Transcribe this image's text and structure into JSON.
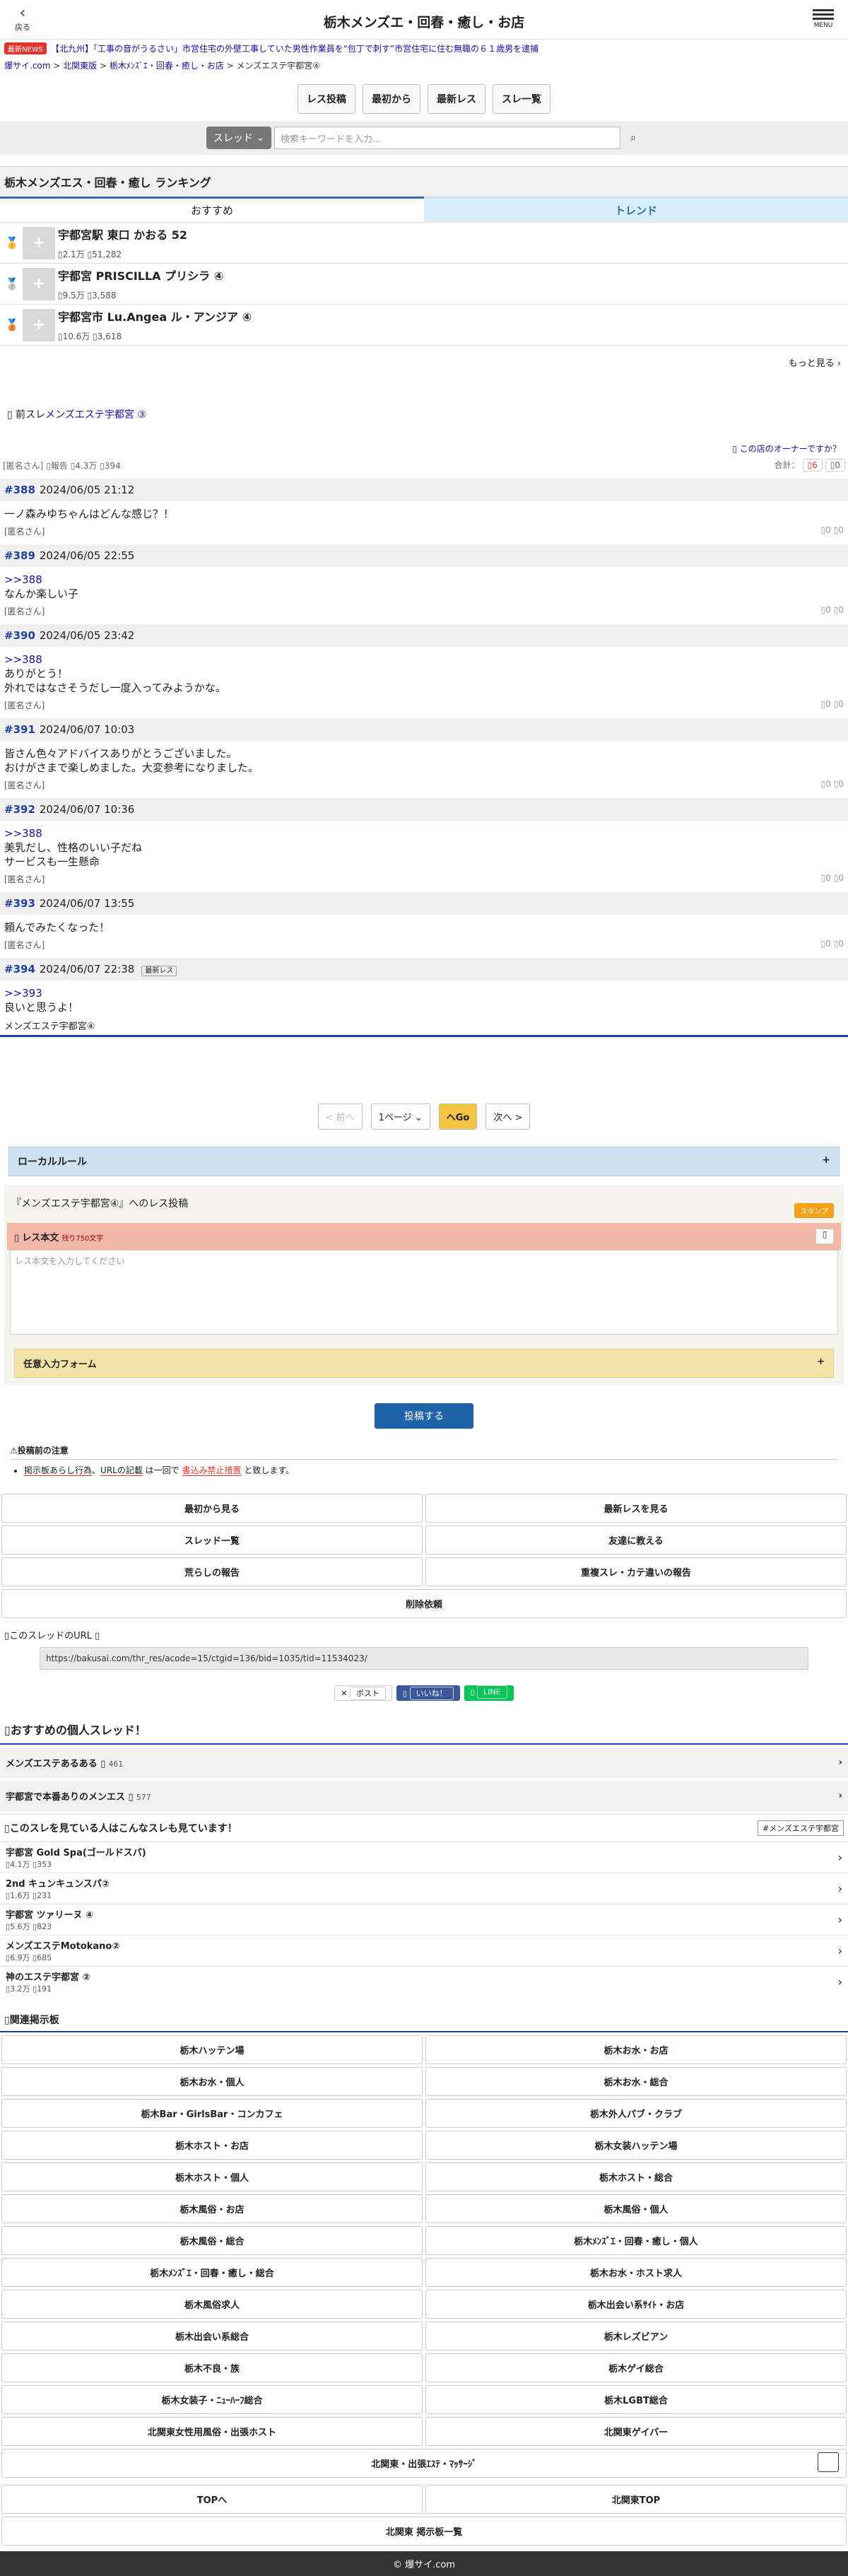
{
  "header": {
    "back_label": "戻る",
    "back_icon": "chevron-left-icon",
    "title": "栃木メンズエ・回春・癒し・お店",
    "menu_label": "MENU",
    "menu_icon": "hamburger-icon"
  },
  "news": {
    "badge": "最新NEWS",
    "text": "【北九州】「工事の音がうるさい」市営住宅の外壁工事していた男性作業員を“包丁で刺す”市営住宅に住む無職の６１歳男を逮捕"
  },
  "breadcrumb": {
    "home": "爆サイ.com",
    "area": "北関東版",
    "board": "栃木ﾒﾝｽﾞｴ・回春・癒し・お店",
    "thread": "メンズエステ宇都宮④"
  },
  "toolbar": {
    "post": "レス投稿",
    "first": "最初から",
    "latest": "最新レス",
    "list": "スレ一覧"
  },
  "search": {
    "select": "スレッド",
    "placeholder": "検索キーワードを入力...",
    "icon": "search-icon"
  },
  "ranking": {
    "title": "栃木メンズエス・回春・癒し ランキング",
    "tab1": "おすすめ",
    "tab2": "トレンド",
    "more": "もっと見る",
    "items": [
      {
        "medal": "gold-medal-icon",
        "title": "宇都宮駅 東口 かおる 52",
        "views": "2.1万",
        "comments": "51,282"
      },
      {
        "medal": "silver-medal-icon",
        "title": "宇都宮 PRISCILLA プリシラ ④",
        "views": "9.5万",
        "comments": "3,588"
      },
      {
        "medal": "bronze-medal-icon",
        "title": "宇都宮市 Lu.Angea ル・アンジア ④",
        "views": "10.6万",
        "comments": "3,618"
      }
    ]
  },
  "thread": {
    "prev_prefix": "前スレ",
    "prev_link": "メンズエステ宇都宮 ③",
    "owner_link": "この店のオーナーですか？",
    "author": "[匿名さん]",
    "report": "報告",
    "views": "4.3万",
    "comments": "394",
    "total_label": "合計：",
    "up_votes": "6",
    "down_votes": "0",
    "posts": [
      {
        "no": "#388",
        "date": "2024/06/05 21:12",
        "anchor": "",
        "body": "一ノ森みゆちゃんはどんな感じ？！",
        "author": "[匿名さん]",
        "up": "0",
        "down": "0"
      },
      {
        "no": "#389",
        "date": "2024/06/05 22:55",
        "anchor": ">>388",
        "body": "なんか楽しい子",
        "author": "[匿名さん]",
        "up": "0",
        "down": "0"
      },
      {
        "no": "#390",
        "date": "2024/06/05 23:42",
        "anchor": ">>388",
        "body": "ありがとう！\n外れではなさそうだし一度入ってみようかな。",
        "author": "[匿名さん]",
        "up": "0",
        "down": "0"
      },
      {
        "no": "#391",
        "date": "2024/06/07 10:03",
        "anchor": "",
        "body": "皆さん色々アドバイスありがとうございました。\nおけがさまで楽しめました。大変参考になりました。",
        "author": "[匿名さん]",
        "up": "0",
        "down": "0"
      },
      {
        "no": "#392",
        "date": "2024/06/07 10:36",
        "anchor": ">>388",
        "body": "美乳だし、性格のいい子だね\nサービスも一生懸命",
        "author": "[匿名さん]",
        "up": "0",
        "down": "0"
      },
      {
        "no": "#393",
        "date": "2024/06/07 13:55",
        "anchor": "",
        "body": "頼んでみたくなった！",
        "author": "[匿名さん]",
        "up": "0",
        "down": "0"
      },
      {
        "no": "#394",
        "date": "2024/06/07 22:38",
        "anchor": ">>393",
        "body": "良いと思うよ！",
        "author": "",
        "up": "",
        "down": "",
        "tag": "最新レス"
      }
    ],
    "end_label": "メンズエステ宇都宮④"
  },
  "pager": {
    "prev": "< 前へ",
    "select": "1ページ",
    "go": "へGo",
    "next": "次へ >"
  },
  "local_rule": {
    "label": "ローカルルール",
    "plus": "+"
  },
  "form": {
    "label": "『メンズエステ宇都宮④』へのレス投稿",
    "stamp": "スタンプ",
    "field": "レス本文",
    "remaining": "残り750文字",
    "placeholder": "レス本文を入力してください",
    "optional": "任意入力フォーム",
    "submit": "投稿する"
  },
  "notes": {
    "title": "⚠投稿前の注意",
    "line_a": "掲示板あらし行為",
    "line_b": "URLの記載",
    "line_c": "は一回で",
    "line_d": "書込み禁止措置",
    "line_e": "と致します。"
  },
  "buttons": [
    "最初から見る",
    "最新レスを見る",
    "スレッド一覧",
    "友達に教える",
    "荒らしの報告",
    "重複スレ・カテ違いの報告",
    "削除依頼"
  ],
  "url": {
    "label": "このスレッドのURL",
    "value": "https://bakusai.com/thr_res/acode=15/ctgid=136/bid=1035/tid=11534023/"
  },
  "share": {
    "x": "ポスト",
    "fb": "いいね！",
    "line": "LINE"
  },
  "recommend": {
    "title": "おすすめの個人スレッド！",
    "items": [
      {
        "name": "メンズエステあるある",
        "count": "461"
      },
      {
        "name": "宇都宮で本番ありのメンエス",
        "count": "577"
      }
    ]
  },
  "seen": {
    "title": "このスレを見ている人はこんなスレも見ています！",
    "tag": "#メンズエステ宇都宮",
    "items": [
      {
        "name": "宇都宮 Gold Spa(ゴールドスパ)",
        "views": "4.1万",
        "comments": "353"
      },
      {
        "name": "2nd キュンキュンスパ②",
        "views": "1.6万",
        "comments": "231"
      },
      {
        "name": "宇都宮 ツァリーヌ ④",
        "views": "5.6万",
        "comments": "823"
      },
      {
        "name": "メンズエステMotokano②",
        "views": "6.9万",
        "comments": "685"
      },
      {
        "name": "神のエステ宇都宮 ②",
        "views": "3.2万",
        "comments": "191"
      }
    ]
  },
  "related": {
    "title": "関連掲示板",
    "items": [
      "栃木ハッテン場",
      "栃木お水・お店",
      "栃木お水・個人",
      "栃木お水・総合",
      "栃木Bar・GirlsBar・コンカフェ",
      "栃木外人パブ・クラブ",
      "栃木ホスト・お店",
      "栃木女装ハッテン場",
      "栃木ホスト・個人",
      "栃木ホスト・総合",
      "栃木風俗・お店",
      "栃木風俗・個人",
      "栃木風俗・総合",
      "栃木ﾒﾝｽﾞｴ・回春・癒し・個人",
      "栃木ﾒﾝｽﾞｴ・回春・癒し・総合",
      "栃木お水・ホスト求人",
      "栃木風俗求人",
      "栃木出会い系ｻｲﾄ・お店",
      "栃木出会い系総合",
      "栃木レズビアン",
      "栃木不良・族",
      "栃木ゲイ総合",
      "栃木女装子・ﾆｭｰﾊｰﾌ総合",
      "栃木LGBT総合",
      "北関東女性用風俗・出張ホスト",
      "北関東ゲイバー"
    ],
    "wide": "北関東・出張ｴｽﾃ・ﾏｯｻｰｼﾞ"
  },
  "bottom": {
    "top": "TOPへ",
    "region": "北関東TOP",
    "list": "北関東 掲示板一覧"
  },
  "footer": "© 爆サイ.com"
}
